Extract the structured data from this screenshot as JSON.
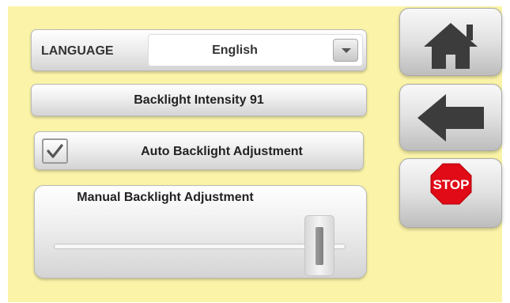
{
  "settings": {
    "language": {
      "label": "LANGUAGE",
      "value": "English"
    },
    "backlight_intensity": {
      "label": "Backlight Intensity",
      "value": 91
    },
    "auto_backlight": {
      "label": "Auto Backlight Adjustment",
      "checked": true
    },
    "manual_backlight": {
      "label": "Manual Backlight Adjustment",
      "slider_fraction": 0.91
    }
  },
  "nav": {
    "home_icon": "home-icon",
    "back_icon": "back-arrow-icon",
    "stop_label": "STOP"
  },
  "colors": {
    "background": "#fbf4a8",
    "stop_red": "#e10a17",
    "icon_dark": "#3c3c3c"
  }
}
